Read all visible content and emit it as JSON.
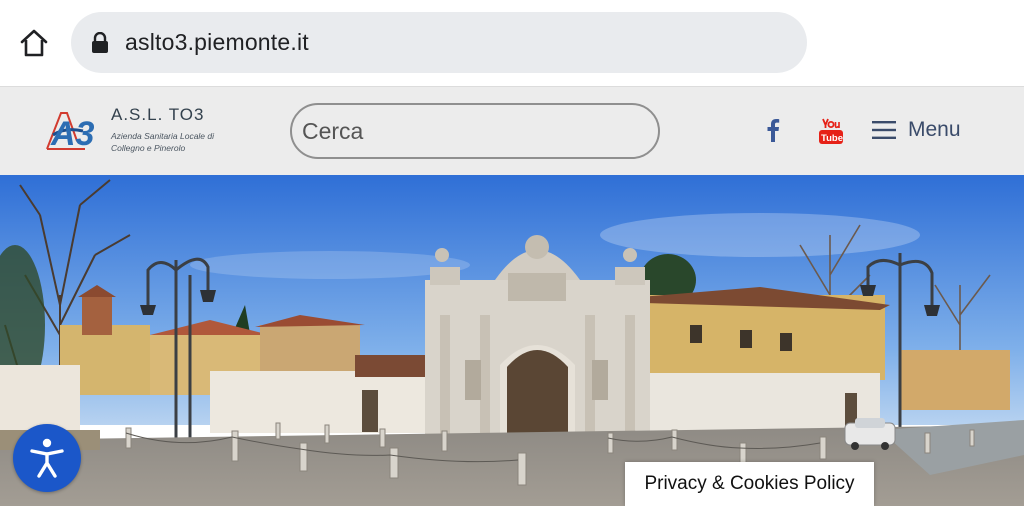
{
  "browser": {
    "url": "aslto3.piemonte.it",
    "home_icon": "home-icon",
    "lock_icon": "lock-icon"
  },
  "header": {
    "logo": {
      "title": "A.S.L. TO3",
      "subtitle": "Azienda Sanitaria Locale di Collegno e Pinerolo",
      "mark_text": "A3"
    },
    "search": {
      "placeholder": "Cerca"
    },
    "social": [
      {
        "name": "facebook-icon"
      },
      {
        "name": "youtube-icon"
      }
    ],
    "menu_label": "Menu"
  },
  "hero": {
    "description": "hero-banner-image"
  },
  "accessibility": {
    "icon": "accessibility-icon"
  },
  "privacy_label": "Privacy & Cookies Policy",
  "colors": {
    "accent_blue": "#1b57c9",
    "header_bg": "#ececec",
    "url_bar_bg": "#e9ebee",
    "menu_text": "#3a4b6a",
    "facebook": "#3b5998",
    "youtube": "#e62117"
  }
}
